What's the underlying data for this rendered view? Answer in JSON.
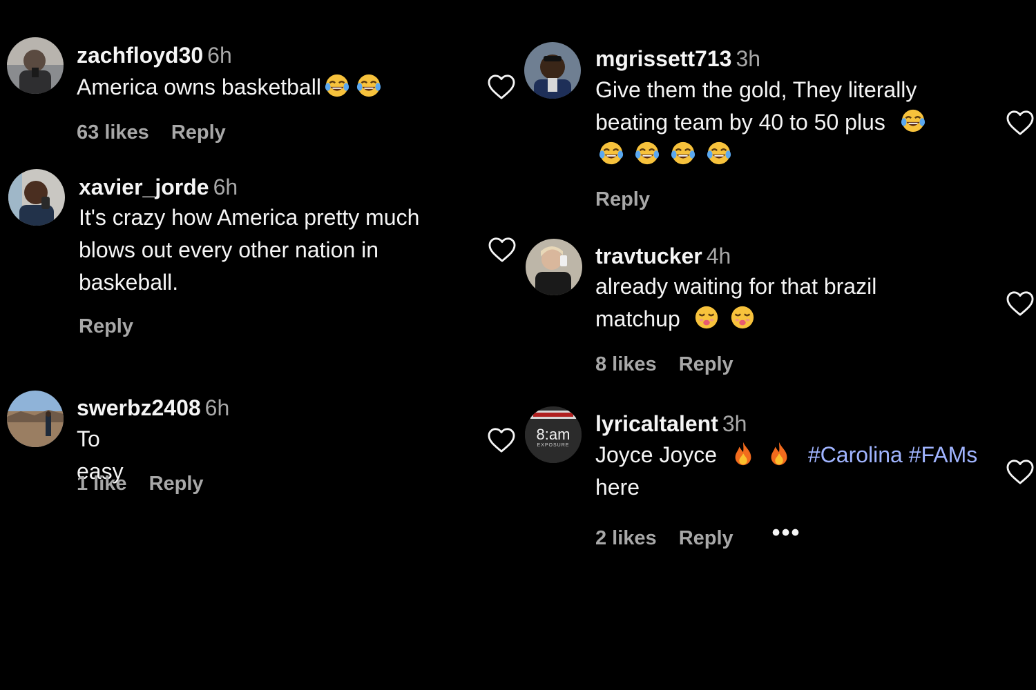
{
  "colors": {
    "background": "#000000",
    "text_primary": "#f5f5f5",
    "text_secondary": "#a8a8a8",
    "hashtag": "#a0b4ff"
  },
  "comments": [
    {
      "username": "zachfloyd30",
      "time": "6h",
      "text": "America owns basketball",
      "emoji": [
        "face-with-tears-of-joy",
        "face-with-tears-of-joy"
      ],
      "likes": "63 likes",
      "reply": "Reply",
      "icon": "heart-outline-icon"
    },
    {
      "username": "xavier_jorde",
      "time": "6h",
      "text": "It's crazy how America pretty much blows out every other nation in baskeball.",
      "likes": "",
      "reply": "Reply",
      "icon": "heart-outline-icon"
    },
    {
      "username": "swerbz2408",
      "time": "6h",
      "text": "To easy",
      "likes": "1 like",
      "reply": "Reply",
      "icon": "heart-outline-icon"
    },
    {
      "username": "mgrissett713",
      "time": "3h",
      "text": "Give them the gold, They literally beating team by 40 to 50 plus",
      "emoji": [
        "face-with-tears-of-joy",
        "face-with-tears-of-joy",
        "face-with-tears-of-joy",
        "face-with-tears-of-joy",
        "face-with-tears-of-joy"
      ],
      "likes": "",
      "reply": "Reply",
      "icon": "heart-outline-icon"
    },
    {
      "username": "travtucker",
      "time": "4h",
      "text": "already waiting for that brazil matchup",
      "emoji": [
        "face-savoring-drool",
        "face-savoring-drool"
      ],
      "likes": "8 likes",
      "reply": "Reply",
      "icon": "heart-outline-icon"
    },
    {
      "username": "lyricaltalent",
      "time": "3h",
      "text_start": "Joyce Joyce",
      "emoji": [
        "fire",
        "fire"
      ],
      "hashtags": "#Carolina #FAMs",
      "text_end": "here",
      "likes": "2 likes",
      "reply": "Reply",
      "more": "•••",
      "icon": "heart-outline-icon",
      "avatar_text": "8:am",
      "avatar_subtext": "EXPOSURE"
    }
  ]
}
